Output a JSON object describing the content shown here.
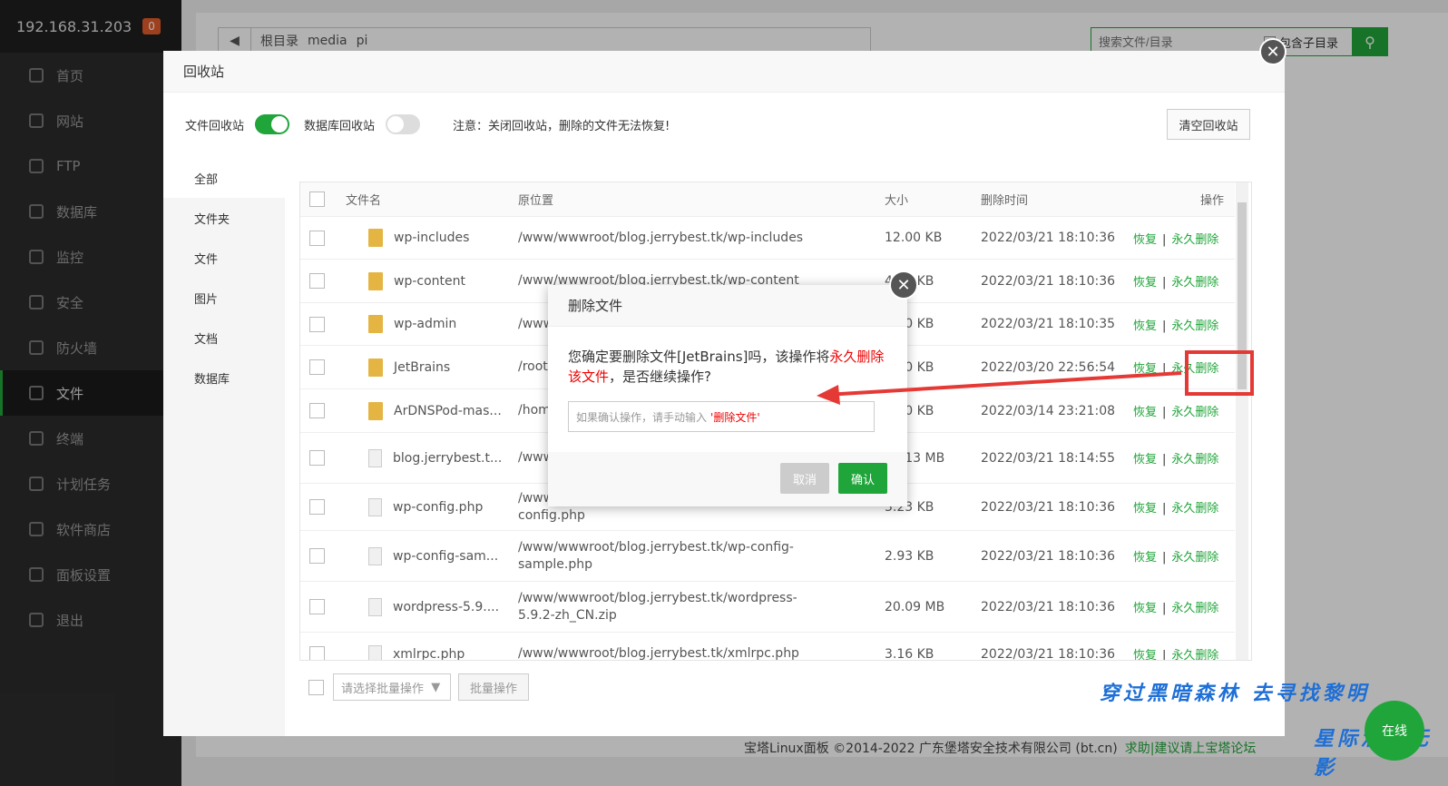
{
  "sidebar": {
    "ip": "192.168.31.203",
    "badge": "0",
    "items": [
      "首页",
      "网站",
      "FTP",
      "数据库",
      "监控",
      "安全",
      "防火墙",
      "文件",
      "终端",
      "计划任务",
      "软件商店",
      "面板设置",
      "退出"
    ]
  },
  "path": {
    "root": "根目录",
    "p1": "media",
    "p2": "pi"
  },
  "search": {
    "placeholder": "搜索文件/目录",
    "sub": "包含子目录"
  },
  "footer": {
    "copy": "宝塔Linux面板 ©2014-2022 广东堡塔安全技术有限公司 (bt.cn)",
    "link": "求助|建议请上宝塔论坛"
  },
  "recycle": {
    "title": "回收站",
    "file_label": "文件回收站",
    "db_label": "数据库回收站",
    "note": "注意：关闭回收站，删除的文件无法恢复!",
    "clear": "清空回收站",
    "cats": [
      "全部",
      "文件夹",
      "文件",
      "图片",
      "文档",
      "数据库"
    ],
    "headers": {
      "name": "文件名",
      "origin": "原位置",
      "size": "大小",
      "time": "删除时间",
      "op": "操作"
    },
    "restore": "恢复",
    "delete": "永久删除",
    "rows": [
      {
        "name": "wp-includes",
        "origin": "/www/wwwroot/blog.jerrybest.tk/wp-includes",
        "size": "12.00 KB",
        "time": "2022/03/21 18:10:36",
        "folder": true
      },
      {
        "name": "wp-content",
        "origin": "/www/wwwroot/blog.jerrybest.tk/wp-content",
        "size": "4.00 KB",
        "time": "2022/03/21 18:10:36",
        "folder": true
      },
      {
        "name": "wp-admin",
        "origin": "/www/wwwroot/blog.jerrybest.tk/wp-admin",
        "size": "4.00 KB",
        "time": "2022/03/21 18:10:35",
        "folder": true
      },
      {
        "name": "JetBrains",
        "origin": "/root/JetBrains",
        "size": "4.00 KB",
        "time": "2022/03/20 22:56:54",
        "folder": true
      },
      {
        "name": "ArDNSPod-mas...",
        "origin": "/home/ArDNSPod-master",
        "size": "4.00 KB",
        "time": "2022/03/14 23:21:08",
        "folder": true
      },
      {
        "name": "blog.jerrybest.t...",
        "origin": "/www/wwwroot/blog.jerrybest.tk_20220321",
        "size": "36.13 MB",
        "time": "2022/03/21 18:14:55",
        "folder": false
      },
      {
        "name": "wp-config.php",
        "origin": "/www/wwwroot/blog.jerrybest.tk/wp-config.php",
        "size": "3.23 KB",
        "time": "2022/03/21 18:10:36",
        "folder": false
      },
      {
        "name": "wp-config-sam...",
        "origin": "/www/wwwroot/blog.jerrybest.tk/wp-config-sample.php",
        "size": "2.93 KB",
        "time": "2022/03/21 18:10:36",
        "folder": false
      },
      {
        "name": "wordpress-5.9....",
        "origin": "/www/wwwroot/blog.jerrybest.tk/wordpress-5.9.2-zh_CN.zip",
        "size": "20.09 MB",
        "time": "2022/03/21 18:10:36",
        "folder": false
      },
      {
        "name": "xmlrpc.php",
        "origin": "/www/wwwroot/blog.jerrybest.tk/xmlrpc.php",
        "size": "3.16 KB",
        "time": "2022/03/21 18:10:36",
        "folder": false
      }
    ],
    "batch_select": "请选择批量操作",
    "batch_btn": "批量操作"
  },
  "dialog": {
    "title": "删除文件",
    "msg_a": "您确定要删除文件[JetBrains]吗，该操作将",
    "msg_red": "永久删除该文件",
    "msg_b": "，是否继续操作?",
    "input_hint": "如果确认操作，请手动输入",
    "input_red": "'删除文件'",
    "cancel": "取消",
    "ok": "确认"
  },
  "watermark": {
    "line1": "穿过黑暗森林 去寻找黎明",
    "line2": "星际酒下无影"
  },
  "online": "在线"
}
